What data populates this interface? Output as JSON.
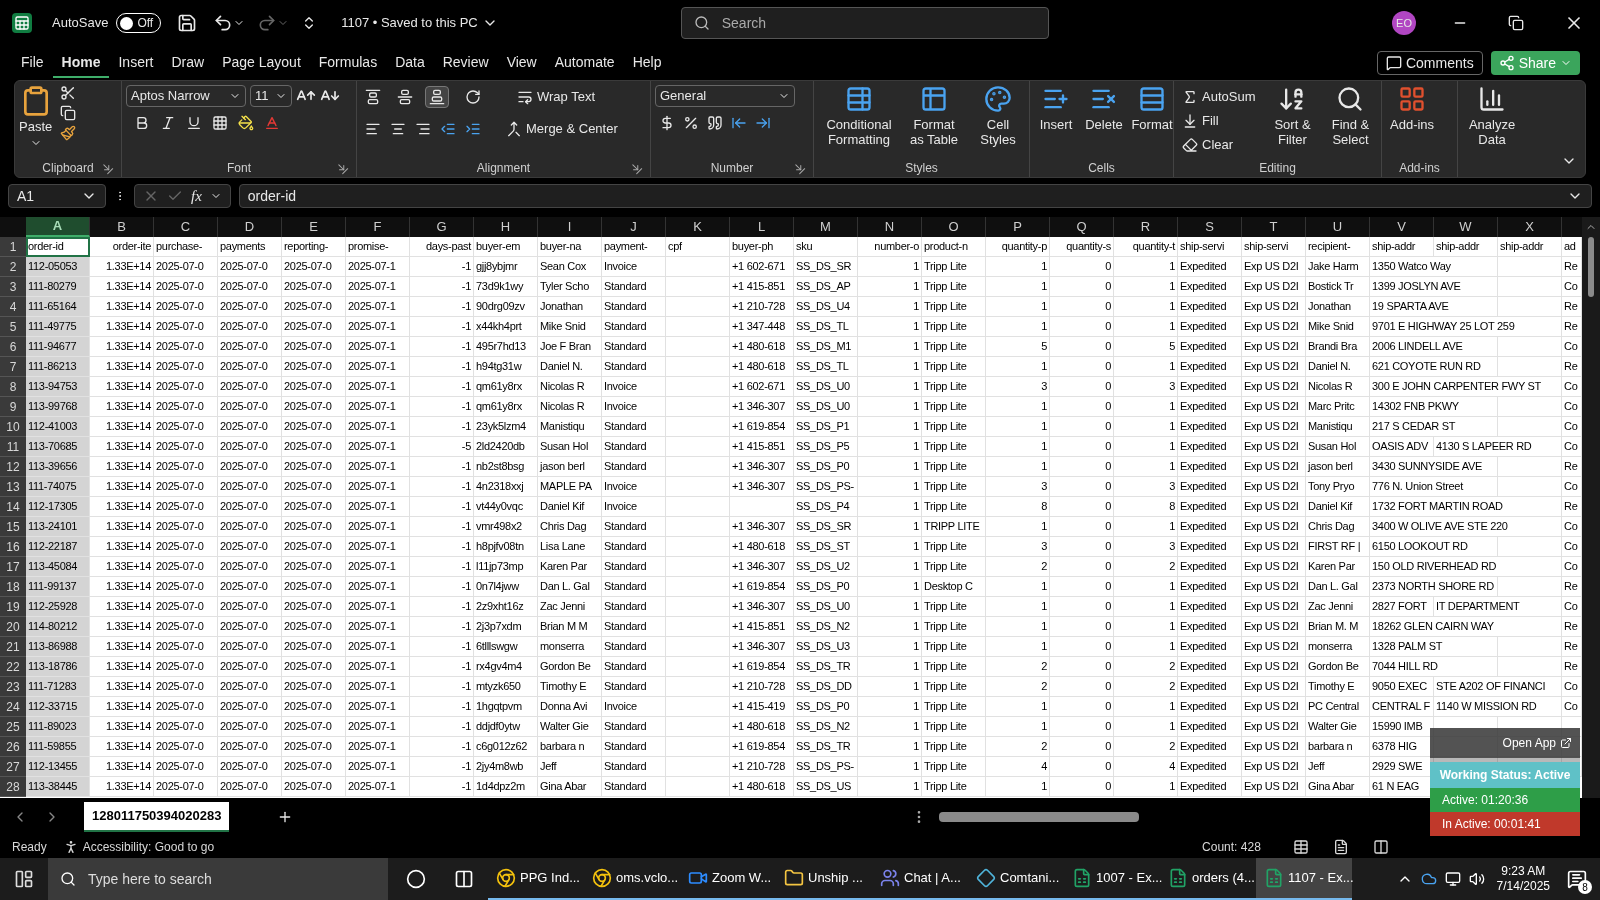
{
  "title_bar": {
    "autosave_label": "AutoSave",
    "autosave": {
      "on": false,
      "label": "Off"
    },
    "document_title": "1107 • Saved to this PC",
    "search": {
      "placeholder": "Search"
    },
    "avatar": "EO"
  },
  "menu_tabs": [
    {
      "label": "File",
      "selected": false
    },
    {
      "label": "Home",
      "selected": true
    },
    {
      "label": "Insert",
      "selected": false
    },
    {
      "label": "Draw",
      "selected": false
    },
    {
      "label": "Page Layout",
      "selected": false
    },
    {
      "label": "Formulas",
      "selected": false
    },
    {
      "label": "Data",
      "selected": false
    },
    {
      "label": "Review",
      "selected": false
    },
    {
      "label": "View",
      "selected": false
    },
    {
      "label": "Automate",
      "selected": false
    },
    {
      "label": "Help",
      "selected": false
    }
  ],
  "comments": "Comments",
  "share": "Share",
  "ribbon": {
    "clipboard": {
      "label": "Clipboard",
      "paste": "Paste"
    },
    "font": {
      "label": "Font",
      "family": "Aptos Narrow",
      "size": "11"
    },
    "alignment": {
      "label": "Alignment",
      "vertical": [
        {
          "selected": false
        },
        {
          "selected": false
        },
        {
          "selected": true
        }
      ],
      "wrap": "Wrap Text",
      "merge": "Merge & Center"
    },
    "number": {
      "label": "Number",
      "format": "General"
    },
    "styles": {
      "label": "Styles",
      "buttons": [
        "Conditional Formatting",
        "Format as Table",
        "Cell Styles"
      ]
    },
    "cells": {
      "label": "Cells",
      "buttons": [
        "Insert",
        "Delete",
        "Format"
      ]
    },
    "editing": {
      "label": "Editing",
      "small": [
        "AutoSum",
        "Fill",
        "Clear"
      ],
      "big": [
        "Sort & Filter",
        "Find & Select"
      ]
    },
    "addins": {
      "label": "Add-ins",
      "button": "Add-ins"
    },
    "analyze": "Analyze Data"
  },
  "formula_bar": {
    "name_box": "A1",
    "fx": "fx",
    "formula": "order-id"
  },
  "columns": [
    {
      "letter": "A",
      "kind": "text",
      "selected": true
    },
    {
      "letter": "B",
      "kind": "number",
      "selected": false
    },
    {
      "letter": "C",
      "kind": "text",
      "selected": false
    },
    {
      "letter": "D",
      "kind": "text",
      "selected": false
    },
    {
      "letter": "E",
      "kind": "text",
      "selected": false
    },
    {
      "letter": "F",
      "kind": "text",
      "selected": false
    },
    {
      "letter": "G",
      "kind": "number",
      "selected": false
    },
    {
      "letter": "H",
      "kind": "text",
      "selected": false
    },
    {
      "letter": "I",
      "kind": "text",
      "selected": false
    },
    {
      "letter": "J",
      "kind": "text",
      "selected": false
    },
    {
      "letter": "K",
      "kind": "text",
      "selected": false
    },
    {
      "letter": "L",
      "kind": "text",
      "selected": false
    },
    {
      "letter": "M",
      "kind": "text",
      "selected": false
    },
    {
      "letter": "N",
      "kind": "number",
      "selected": false
    },
    {
      "letter": "O",
      "kind": "text",
      "selected": false
    },
    {
      "letter": "P",
      "kind": "number",
      "selected": false
    },
    {
      "letter": "Q",
      "kind": "number",
      "selected": false
    },
    {
      "letter": "R",
      "kind": "number",
      "selected": false
    },
    {
      "letter": "S",
      "kind": "text",
      "selected": false
    },
    {
      "letter": "T",
      "kind": "text",
      "selected": false
    },
    {
      "letter": "U",
      "kind": "text",
      "selected": false
    },
    {
      "letter": "V",
      "kind": "text",
      "selected": false
    },
    {
      "letter": "W",
      "kind": "text",
      "selected": false
    },
    {
      "letter": "X",
      "kind": "text",
      "selected": false
    },
    {
      "kind": "text"
    }
  ],
  "rows": [
    {
      "number": "1",
      "cells": [
        "order-id",
        "order-ite",
        "purchase-",
        "payments",
        "reporting-",
        "promise-",
        "days-past",
        "buyer-em",
        "buyer-na",
        "payment-",
        "cpf",
        "buyer-ph",
        "sku",
        "number-o",
        "product-n",
        "quantity-p",
        "quantity-s",
        "quantity-t",
        "ship-servi",
        "ship-servi",
        "recipient-",
        "ship-addr",
        "ship-addr",
        "ship-addr",
        "ad"
      ]
    },
    {
      "number": "2",
      "cells": [
        "112-05053",
        "1.33E+14",
        "2025-07-0",
        "2025-07-0",
        "2025-07-0",
        "2025-07-1",
        "-1",
        "gjj8ybjmr",
        "Sean Cox",
        "Invoice",
        "",
        "+1 602-671",
        "SS_DS_SR",
        "1",
        "Tripp Lite",
        "1",
        "0",
        "1",
        "Expedited",
        "Exp US D2I",
        "Jake Harm",
        "1350 Watco Way",
        "",
        "",
        "Re"
      ]
    },
    {
      "number": "3",
      "cells": [
        "111-80279",
        "1.33E+14",
        "2025-07-0",
        "2025-07-0",
        "2025-07-0",
        "2025-07-1",
        "-1",
        "73d9k1wy",
        "Tyler Scho",
        "Standard",
        "",
        "+1 415-851",
        "SS_DS_AP",
        "1",
        "Tripp Lite",
        "1",
        "0",
        "1",
        "Expedited",
        "Exp US D2I",
        "Bostick Tr",
        "1399 JOSLYN AVE",
        "",
        "",
        "Co"
      ]
    },
    {
      "number": "4",
      "cells": [
        "111-65164",
        "1.33E+14",
        "2025-07-0",
        "2025-07-0",
        "2025-07-0",
        "2025-07-1",
        "-1",
        "90drg09zv",
        "Jonathan",
        "Standard",
        "",
        "+1 210-728",
        "SS_DS_U4",
        "1",
        "Tripp Lite",
        "1",
        "0",
        "1",
        "Expedited",
        "Exp US D2I",
        "Jonathan",
        "19 SPARTA AVE",
        "",
        "",
        "Re"
      ]
    },
    {
      "number": "5",
      "cells": [
        "111-49775",
        "1.33E+14",
        "2025-07-0",
        "2025-07-0",
        "2025-07-0",
        "2025-07-1",
        "-1",
        "x44kh4prt",
        "Mike Snid",
        "Standard",
        "",
        "+1 347-448",
        "SS_DS_TL",
        "1",
        "Tripp Lite",
        "1",
        "0",
        "1",
        "Expedited",
        "Exp US D2I",
        "Mike Snid",
        "9701 E HIGHWAY 25 LOT 259",
        "",
        "",
        "Re"
      ]
    },
    {
      "number": "6",
      "cells": [
        "111-94677",
        "1.33E+14",
        "2025-07-0",
        "2025-07-0",
        "2025-07-0",
        "2025-07-1",
        "-1",
        "495r7hd13",
        "Joe F Bran",
        "Standard",
        "",
        "+1 480-618",
        "SS_DS_M1",
        "1",
        "Tripp Lite",
        "5",
        "0",
        "5",
        "Expedited",
        "Exp US D2I",
        "Brandi Bra",
        "2006 LINDELL AVE",
        "",
        "",
        "Co"
      ]
    },
    {
      "number": "7",
      "cells": [
        "111-86213",
        "1.33E+14",
        "2025-07-0",
        "2025-07-0",
        "2025-07-0",
        "2025-07-1",
        "-1",
        "h94tg31w",
        "Daniel N.",
        "Standard",
        "",
        "+1 480-618",
        "SS_DS_TL",
        "1",
        "Tripp Lite",
        "1",
        "0",
        "1",
        "Expedited",
        "Exp US D2I",
        "Daniel N.",
        "621 COYOTE RUN RD",
        "",
        "",
        "Re"
      ]
    },
    {
      "number": "8",
      "cells": [
        "113-94753",
        "1.33E+14",
        "2025-07-0",
        "2025-07-0",
        "2025-07-0",
        "2025-07-1",
        "-1",
        "qm61y8rx",
        "Nicolas R",
        "Invoice",
        "",
        "+1 602-671",
        "SS_DS_U0",
        "1",
        "Tripp Lite",
        "3",
        "0",
        "3",
        "Expedited",
        "Exp US D2I",
        "Nicolas R",
        "300 E JOHN CARPENTER FWY ST",
        "",
        "",
        "Co"
      ]
    },
    {
      "number": "9",
      "cells": [
        "113-99768",
        "1.33E+14",
        "2025-07-0",
        "2025-07-0",
        "2025-07-0",
        "2025-07-1",
        "-1",
        "qm61y8rx",
        "Nicolas R",
        "Invoice",
        "",
        "+1 346-307",
        "SS_DS_U0",
        "1",
        "Tripp Lite",
        "1",
        "0",
        "1",
        "Expedited",
        "Exp US D2I",
        "Marc Pritc",
        "14302 FNB PKWY",
        "",
        "",
        "Co"
      ]
    },
    {
      "number": "10",
      "cells": [
        "112-41003",
        "1.33E+14",
        "2025-07-0",
        "2025-07-0",
        "2025-07-0",
        "2025-07-1",
        "-1",
        "23yk5lzm4",
        "Manistiqu",
        "Standard",
        "",
        "+1 619-854",
        "SS_DS_P1",
        "1",
        "Tripp Lite",
        "1",
        "0",
        "1",
        "Expedited",
        "Exp US D2I",
        "Manistiqu",
        "217 S CEDAR ST",
        "",
        "",
        "Co"
      ]
    },
    {
      "number": "11",
      "cells": [
        "113-70685",
        "1.33E+14",
        "2025-07-0",
        "2025-07-0",
        "2025-07-0",
        "2025-07-1",
        "-5",
        "2ld2420db",
        "Susan Hol",
        "Standard",
        "",
        "+1 415-851",
        "SS_DS_P5",
        "1",
        "Tripp Lite",
        "1",
        "0",
        "1",
        "Expedited",
        "Exp US D2I",
        "Susan Hol",
        "OASIS ADV",
        "4130 S LAPEER RD",
        "",
        "Co"
      ]
    },
    {
      "number": "12",
      "cells": [
        "113-39656",
        "1.33E+14",
        "2025-07-0",
        "2025-07-0",
        "2025-07-0",
        "2025-07-1",
        "-1",
        "nb2st8bsg",
        "jason berl",
        "Standard",
        "",
        "+1 346-307",
        "SS_DS_P0",
        "1",
        "Tripp Lite",
        "1",
        "0",
        "1",
        "Expedited",
        "Exp US D2I",
        "jason berl",
        "3430 SUNNYSIDE AVE",
        "",
        "",
        "Re"
      ]
    },
    {
      "number": "13",
      "cells": [
        "111-74075",
        "1.33E+14",
        "2025-07-0",
        "2025-07-0",
        "2025-07-0",
        "2025-07-1",
        "-1",
        "4n2318xxj",
        "MAPLE PA",
        "Invoice",
        "",
        "+1 346-307",
        "SS_DS_PS-",
        "1",
        "Tripp Lite",
        "3",
        "0",
        "3",
        "Expedited",
        "Exp US D2I",
        "Tony Pryo",
        "776 N. Union Street",
        "",
        "",
        "Co"
      ]
    },
    {
      "number": "14",
      "cells": [
        "112-17305",
        "1.33E+14",
        "2025-07-0",
        "2025-07-0",
        "2025-07-0",
        "2025-07-1",
        "-1",
        "vt44y0vqc",
        "Daniel Kif",
        "Invoice",
        "",
        "",
        "SS_DS_P4",
        "1",
        "Tripp Lite",
        "8",
        "0",
        "8",
        "Expedited",
        "Exp US D2I",
        "Daniel Kif",
        "1732 FORT MARTIN ROAD",
        "",
        "",
        "Re"
      ]
    },
    {
      "number": "15",
      "cells": [
        "113-24101",
        "1.33E+14",
        "2025-07-0",
        "2025-07-0",
        "2025-07-0",
        "2025-07-1",
        "-1",
        "vmr498x2",
        "Chris Dag",
        "Standard",
        "",
        "+1 346-307",
        "SS_DS_SR",
        "1",
        "TRIPP LITE",
        "1",
        "0",
        "1",
        "Expedited",
        "Exp US D2I",
        "Chris Dag",
        "3400 W OLIVE AVE STE 220",
        "",
        "",
        "Co"
      ]
    },
    {
      "number": "16",
      "cells": [
        "112-22187",
        "1.33E+14",
        "2025-07-0",
        "2025-07-0",
        "2025-07-0",
        "2025-07-1",
        "-1",
        "h8pjfv08tn",
        "Lisa Lane",
        "Standard",
        "",
        "+1 480-618",
        "SS_DS_ST",
        "1",
        "Tripp Lite",
        "3",
        "0",
        "3",
        "Expedited",
        "Exp US D2I",
        "FIRST RF |",
        "6150 LOOKOUT RD",
        "",
        "",
        "Co"
      ]
    },
    {
      "number": "17",
      "cells": [
        "113-45084",
        "1.33E+14",
        "2025-07-0",
        "2025-07-0",
        "2025-07-0",
        "2025-07-1",
        "-1",
        "l11jp73mp",
        "Karen Par",
        "Standard",
        "",
        "+1 346-307",
        "SS_DS_U2",
        "1",
        "Tripp Lite",
        "2",
        "0",
        "2",
        "Expedited",
        "Exp US D2I",
        "Karen Par",
        "150 OLD RIVERHEAD RD",
        "",
        "",
        "Co"
      ]
    },
    {
      "number": "18",
      "cells": [
        "111-99137",
        "1.33E+14",
        "2025-07-0",
        "2025-07-0",
        "2025-07-0",
        "2025-07-1",
        "-1",
        "0n7l4jww",
        "Dan L. Gal",
        "Standard",
        "",
        "+1 619-854",
        "SS_DS_P0",
        "1",
        "Desktop C",
        "1",
        "0",
        "1",
        "Expedited",
        "Exp US D2I",
        "Dan L. Gal",
        "2373 NORTH SHORE RD",
        "",
        "",
        "Re"
      ]
    },
    {
      "number": "19",
      "cells": [
        "112-25928",
        "1.33E+14",
        "2025-07-0",
        "2025-07-0",
        "2025-07-0",
        "2025-07-1",
        "-1",
        "2z9xht16z",
        "Zac Jenni",
        "Standard",
        "",
        "+1 346-307",
        "SS_DS_U0",
        "1",
        "Tripp Lite",
        "1",
        "0",
        "1",
        "Expedited",
        "Exp US D2I",
        "Zac Jenni",
        "2827 FORT",
        "IT DEPARTMENT",
        "",
        "Co"
      ]
    },
    {
      "number": "20",
      "cells": [
        "114-80212",
        "1.33E+14",
        "2025-07-0",
        "2025-07-0",
        "2025-07-0",
        "2025-07-1",
        "-1",
        "2j3p7xdm",
        "Brian M M",
        "Standard",
        "",
        "+1 415-851",
        "SS_DS_N2",
        "1",
        "Tripp Lite",
        "1",
        "0",
        "1",
        "Expedited",
        "Exp US D2I",
        "Brian M. M",
        "18262 GLEN CAIRN WAY",
        "",
        "",
        "Re"
      ]
    },
    {
      "number": "21",
      "cells": [
        "113-86988",
        "1.33E+14",
        "2025-07-0",
        "2025-07-0",
        "2025-07-0",
        "2025-07-1",
        "-1",
        "6tlllswgw",
        "monserra",
        "Standard",
        "",
        "+1 346-307",
        "SS_DS_U3",
        "1",
        "Tripp Lite",
        "1",
        "0",
        "1",
        "Expedited",
        "Exp US D2I",
        "monserra",
        "1328 PALM ST",
        "",
        "",
        "Re"
      ]
    },
    {
      "number": "22",
      "cells": [
        "113-18786",
        "1.33E+14",
        "2025-07-0",
        "2025-07-0",
        "2025-07-0",
        "2025-07-1",
        "-1",
        "rx4gv4m4",
        "Gordon Be",
        "Standard",
        "",
        "+1 619-854",
        "SS_DS_TR",
        "1",
        "Tripp Lite",
        "2",
        "0",
        "2",
        "Expedited",
        "Exp US D2I",
        "Gordon Be",
        "7044 HILL RD",
        "",
        "",
        "Re"
      ]
    },
    {
      "number": "23",
      "cells": [
        "111-71283",
        "1.33E+14",
        "2025-07-0",
        "2025-07-0",
        "2025-07-0",
        "2025-07-1",
        "-1",
        "mtyzk650",
        "Timothy E",
        "Standard",
        "",
        "+1 210-728",
        "SS_DS_DD",
        "1",
        "Tripp Lite",
        "2",
        "0",
        "2",
        "Expedited",
        "Exp US D2I",
        "Timothy E",
        "9050 EXEC",
        "STE A202 OF FINANCI",
        "",
        "Co"
      ]
    },
    {
      "number": "24",
      "cells": [
        "112-33715",
        "1.33E+14",
        "2025-07-0",
        "2025-07-0",
        "2025-07-0",
        "2025-07-1",
        "-1",
        "1hgqtpvm",
        "Donna Avi",
        "Invoice",
        "",
        "+1 415-419",
        "SS_DS_P0",
        "1",
        "Tripp Lite",
        "1",
        "0",
        "1",
        "Expedited",
        "Exp US D2I",
        "PC Central",
        "CENTRAL F",
        "1140 W MISSION RD",
        "",
        "Co"
      ]
    },
    {
      "number": "25",
      "cells": [
        "111-89023",
        "1.33E+14",
        "2025-07-0",
        "2025-07-0",
        "2025-07-0",
        "2025-07-1",
        "-1",
        "ddjdf0ytw",
        "Walter Gie",
        "Standard",
        "",
        "+1 480-618",
        "SS_DS_N2",
        "1",
        "Tripp Lite",
        "1",
        "0",
        "1",
        "Expedited",
        "Exp US D2I",
        "Walter Gie",
        "15990 IMB",
        "",
        "",
        ""
      ]
    },
    {
      "number": "26",
      "cells": [
        "111-59855",
        "1.33E+14",
        "2025-07-0",
        "2025-07-0",
        "2025-07-0",
        "2025-07-1",
        "-1",
        "c6g012z62",
        "barbara n",
        "Standard",
        "",
        "+1 619-854",
        "SS_DS_TR",
        "1",
        "Tripp Lite",
        "2",
        "0",
        "2",
        "Expedited",
        "Exp US D2I",
        "barbara n",
        "6378 HIG",
        "",
        "",
        ""
      ]
    },
    {
      "number": "27",
      "cells": [
        "112-13455",
        "1.33E+14",
        "2025-07-0",
        "2025-07-0",
        "2025-07-0",
        "2025-07-1",
        "-1",
        "2jy4m8wb",
        "Jeff",
        "Standard",
        "",
        "+1 210-728",
        "SS_DS_PS-",
        "1",
        "Tripp Lite",
        "4",
        "0",
        "4",
        "Expedited",
        "Exp US D2I",
        "Jeff",
        "2929 SWE",
        "",
        "",
        ""
      ]
    },
    {
      "number": "28",
      "cells": [
        "113-38445",
        "1.33E+14",
        "2025-07-0",
        "2025-07-0",
        "2025-07-0",
        "2025-07-1",
        "-1",
        "1d4dpz2m",
        "Gina Abar",
        "Standard",
        "",
        "+1 480-618",
        "SS_DS_US",
        "1",
        "Tripp Lite",
        "1",
        "0",
        "1",
        "Expedited",
        "Exp US D2I",
        "Gina Abar",
        "61 N EAG",
        "",
        "",
        ""
      ]
    }
  ],
  "sheet_tabs": [
    {
      "label": "128011750394020283",
      "selected": true
    }
  ],
  "status_bar": {
    "ready": "Ready",
    "accessibility": "Accessibility: Good to go",
    "count": "Count: 428"
  },
  "timer_widget": {
    "open_app": "Open App",
    "status": "Working Status: Active",
    "active": "Active: 01:20:36",
    "inactive": "In Active: 00:01:41"
  },
  "taskbar": {
    "search": {
      "placeholder": "Type here to search"
    },
    "apps": [
      {
        "label": "PPG Ind...",
        "kind": "chrome",
        "selected": false
      },
      {
        "label": "oms.vclo...",
        "kind": "chrome",
        "selected": false
      },
      {
        "label": "Zoom W...",
        "kind": "zoom",
        "selected": false
      },
      {
        "label": "Unship ...",
        "kind": "folder",
        "selected": false
      },
      {
        "label": "Chat | A...",
        "kind": "teams",
        "selected": false
      },
      {
        "label": "Comtani...",
        "kind": "diamond",
        "selected": false
      },
      {
        "label": "1007 - Ex...",
        "kind": "excel",
        "selected": false
      },
      {
        "label": "orders (4...",
        "kind": "excel",
        "selected": false
      },
      {
        "label": "1107 - Ex...",
        "kind": "excel",
        "selected": true
      }
    ],
    "time": "9:23 AM",
    "date": "7/14/2025",
    "notifications": "8"
  }
}
